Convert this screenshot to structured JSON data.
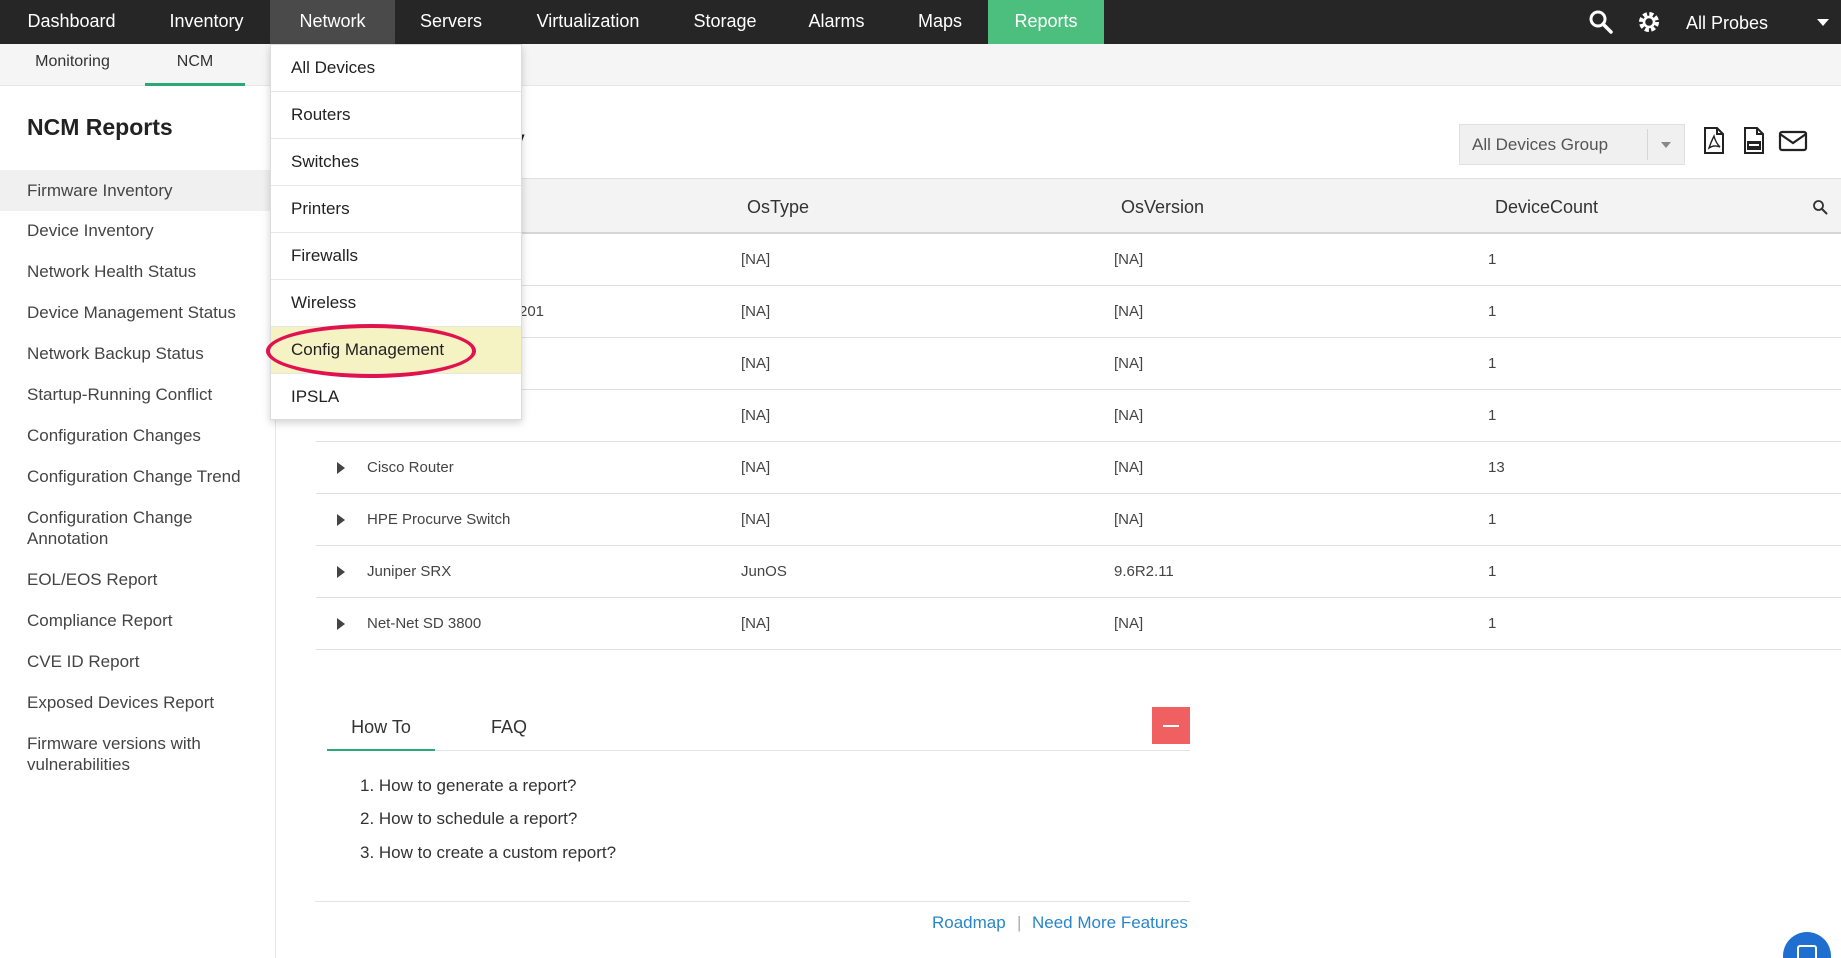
{
  "topnav": {
    "items": [
      {
        "label": "Dashboard"
      },
      {
        "label": "Inventory"
      },
      {
        "label": "Network"
      },
      {
        "label": "Servers"
      },
      {
        "label": "Virtualization"
      },
      {
        "label": "Storage"
      },
      {
        "label": "Alarms"
      },
      {
        "label": "Maps"
      },
      {
        "label": "Reports"
      }
    ],
    "search_icon": "search-icon",
    "settings_icon": "gear-icon",
    "probe_select": "All Probes"
  },
  "subnav": {
    "items": [
      {
        "label": "Monitoring"
      },
      {
        "label": "NCM"
      }
    ]
  },
  "network_menu": {
    "items": [
      {
        "label": "All Devices"
      },
      {
        "label": "Routers"
      },
      {
        "label": "Switches"
      },
      {
        "label": "Printers"
      },
      {
        "label": "Firewalls"
      },
      {
        "label": "Wireless"
      },
      {
        "label": "Config Management"
      },
      {
        "label": "IPSLA"
      }
    ]
  },
  "sidebar": {
    "title": "NCM Reports",
    "items": [
      {
        "label": "Firmware Inventory"
      },
      {
        "label": "Device Inventory"
      },
      {
        "label": "Network Health Status"
      },
      {
        "label": "Device Management Status"
      },
      {
        "label": "Network Backup Status"
      },
      {
        "label": "Startup-Running Conflict"
      },
      {
        "label": "Configuration Changes"
      },
      {
        "label": "Configuration Change Trend"
      },
      {
        "label": "Configuration Change Annotation"
      },
      {
        "label": "EOL/EOS Report"
      },
      {
        "label": "Compliance Report"
      },
      {
        "label": "CVE ID Report"
      },
      {
        "label": "Exposed Devices Report"
      },
      {
        "label": "Firmware versions with vulnerabilities"
      }
    ]
  },
  "main": {
    "title_visible": "ry",
    "group_select": "All Devices Group",
    "export_icons": [
      "pdf-icon",
      "csv-icon",
      "email-icon"
    ],
    "table": {
      "headers": [
        "OsType",
        "OsVersion",
        "DeviceCount"
      ],
      "rows": [
        {
          "name": "",
          "ostype": "[NA]",
          "osversion": "[NA]",
          "count": "1"
        },
        {
          "name": "201",
          "ostype": "[NA]",
          "osversion": "[NA]",
          "count": "1"
        },
        {
          "name": "",
          "ostype": "[NA]",
          "osversion": "[NA]",
          "count": "1"
        },
        {
          "name": "",
          "ostype": "[NA]",
          "osversion": "[NA]",
          "count": "1"
        },
        {
          "name": "Cisco Router",
          "ostype": "[NA]",
          "osversion": "[NA]",
          "count": "13"
        },
        {
          "name": "HPE Procurve Switch",
          "ostype": "[NA]",
          "osversion": "[NA]",
          "count": "1"
        },
        {
          "name": "Juniper SRX",
          "ostype": "JunOS",
          "osversion": "9.6R2.11",
          "count": "1"
        },
        {
          "name": "Net-Net SD 3800",
          "ostype": "[NA]",
          "osversion": "[NA]",
          "count": "1"
        }
      ]
    }
  },
  "help": {
    "tabs": [
      {
        "label": "How To"
      },
      {
        "label": "FAQ"
      }
    ],
    "items": [
      {
        "label": "1. How to generate a report?"
      },
      {
        "label": "2. How to schedule a report?"
      },
      {
        "label": "3. How to create a custom report?"
      }
    ],
    "links": {
      "roadmap": "Roadmap",
      "separator": "|",
      "more_features": "Need More Features"
    }
  },
  "colors": {
    "topnav_bg": "#262626",
    "reports_active": "#4cbf7e",
    "accent_green": "#2aa876",
    "highlight_ring": "#e0134e",
    "menu_highlight": "#f5f2c4",
    "link_blue": "#2a86c9",
    "collapse_red": "#f06060"
  }
}
